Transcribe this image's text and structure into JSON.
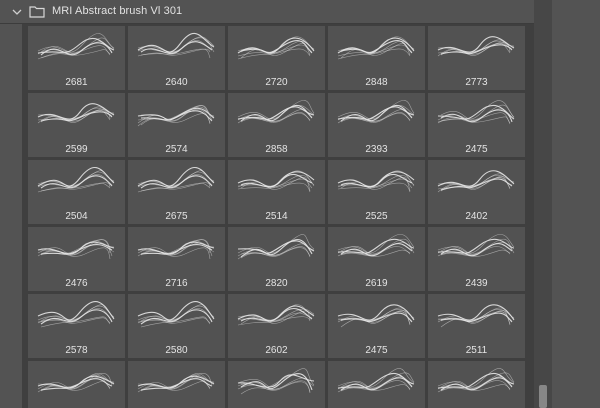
{
  "set": {
    "name": "MRI Abstract brush Vl 301",
    "icon_expand": "chevron-down-icon",
    "icon_folder": "folder-icon"
  },
  "brushes": [
    {
      "size": "2681"
    },
    {
      "size": "2640"
    },
    {
      "size": "2720"
    },
    {
      "size": "2848"
    },
    {
      "size": "2773"
    },
    {
      "size": "2599"
    },
    {
      "size": "2574"
    },
    {
      "size": "2858"
    },
    {
      "size": "2393"
    },
    {
      "size": "2475"
    },
    {
      "size": "2504"
    },
    {
      "size": "2675"
    },
    {
      "size": "2514"
    },
    {
      "size": "2525"
    },
    {
      "size": "2402"
    },
    {
      "size": "2476"
    },
    {
      "size": "2716"
    },
    {
      "size": "2820"
    },
    {
      "size": "2619"
    },
    {
      "size": "2439"
    },
    {
      "size": "2578"
    },
    {
      "size": "2580"
    },
    {
      "size": "2602"
    },
    {
      "size": "2475"
    },
    {
      "size": "2511"
    },
    {
      "size": ""
    },
    {
      "size": ""
    },
    {
      "size": ""
    },
    {
      "size": ""
    },
    {
      "size": ""
    }
  ],
  "colors": {
    "panel": "#535353",
    "grid_bg": "#3f3f3f",
    "cell": "#525252",
    "stroke": "#e6e6e6"
  }
}
